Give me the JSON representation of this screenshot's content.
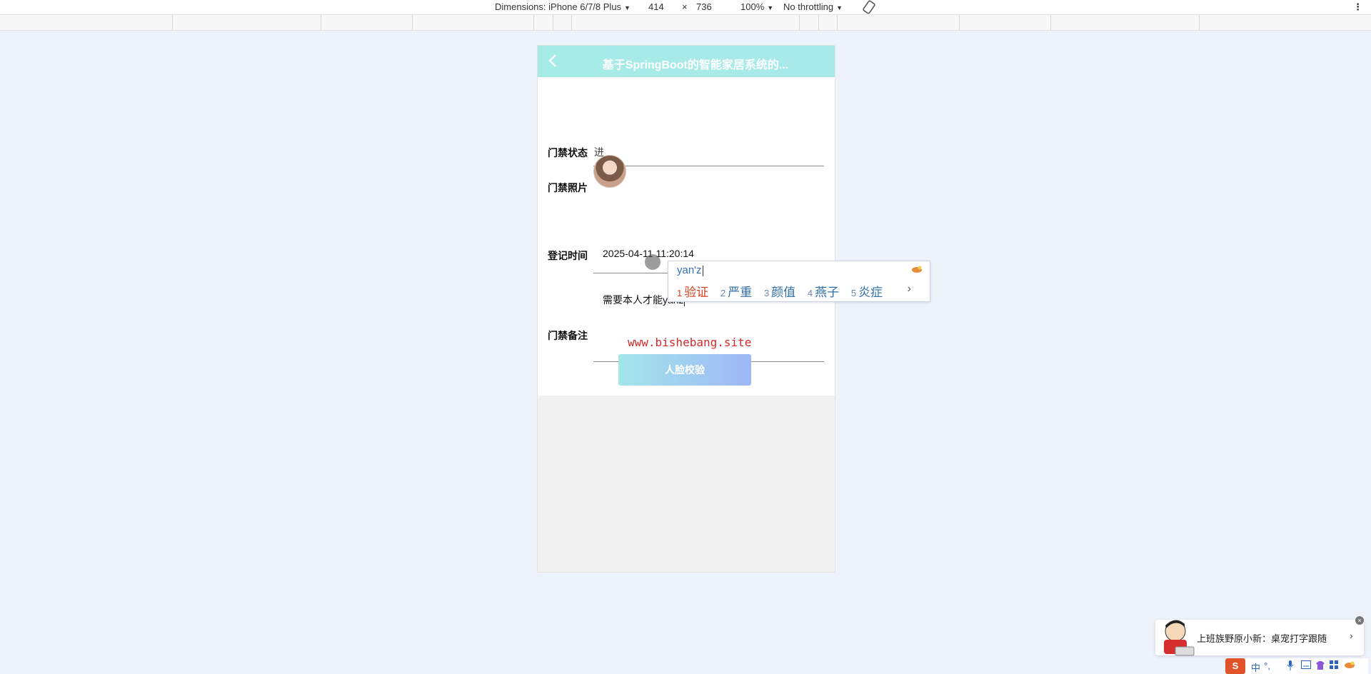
{
  "devtools": {
    "dimensions_label": "Dimensions: iPhone 6/7/8 Plus",
    "width": "414",
    "times": "×",
    "height": "736",
    "zoom": "100%",
    "throttling": "No throttling",
    "more_icon": "⋮"
  },
  "page": {
    "title": "基于SpringBoot的智能家居系统的...",
    "fields": {
      "status_label": "门禁状态",
      "status_value": "进",
      "photo_label": "门禁照片",
      "time_label": "登记时间",
      "time_value": "2025-04-11 11:20:14",
      "remark_label": "门禁备注",
      "remark_value": "需要本人才能yanz"
    },
    "watermark": "www.bishebang.site",
    "button_label": "人脸校验"
  },
  "ime": {
    "input": "yan'z",
    "candidates": [
      {
        "num": "1",
        "text": "验证"
      },
      {
        "num": "2",
        "text": "严重"
      },
      {
        "num": "3",
        "text": "颜值"
      },
      {
        "num": "4",
        "text": "燕子"
      },
      {
        "num": "5",
        "text": "炎症"
      }
    ],
    "next": "›"
  },
  "notification": {
    "text": "上班族野原小新：桌宠打字跟随",
    "arrow": "›",
    "close": "×"
  },
  "ime_toolbar": {
    "logo": "S",
    "mode": "中",
    "punct": "°,"
  },
  "colors": {
    "header_start": "#a6ece6",
    "button_end": "#9fb7f7",
    "watermark": "#d42a2a"
  }
}
